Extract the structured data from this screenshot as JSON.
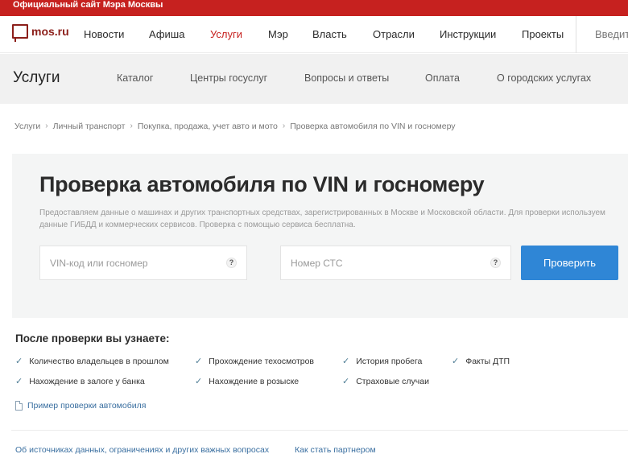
{
  "topbar": {
    "title": "Официальный сайт Мэра Москвы"
  },
  "header": {
    "logo_text": "mos.ru",
    "nav": [
      {
        "label": "Новости",
        "active": false
      },
      {
        "label": "Афиша",
        "active": false
      },
      {
        "label": "Услуги",
        "active": true
      },
      {
        "label": "Мэр",
        "active": false
      },
      {
        "label": "Власть",
        "active": false
      },
      {
        "label": "Отрасли",
        "active": false
      },
      {
        "label": "Инструкции",
        "active": false
      },
      {
        "label": "Проекты",
        "active": false
      }
    ],
    "search_placeholder": "Введите"
  },
  "subnav": {
    "title": "Услуги",
    "items": [
      "Каталог",
      "Центры госуслуг",
      "Вопросы и ответы",
      "Оплата",
      "О городских услугах"
    ]
  },
  "breadcrumb": {
    "items": [
      "Услуги",
      "Личный транспорт",
      "Покупка, продажа, учет авто и мото",
      "Проверка автомобиля по VIN и госномеру"
    ],
    "separator": "›"
  },
  "main": {
    "title": "Проверка автомобиля по VIN и госномеру",
    "description": "Предоставляем данные о машинах и других транспортных средствах, зарегистрированных в Москве и Московской области. Для проверки используем данные ГИБДД и коммерческих сервисов. Проверка с помощью сервиса бесплатна.",
    "vin_field": {
      "placeholder": "VIN-код или госномер",
      "value": "",
      "help": "?"
    },
    "sts_field": {
      "placeholder": "Номер СТС",
      "value": "",
      "help": "?"
    },
    "submit_label": "Проверить"
  },
  "results": {
    "title": "После проверки вы узнаете:",
    "features": [
      "Количество владельцев в прошлом",
      "Прохождение техосмотров",
      "История пробега",
      "Факты ДТП",
      "Нахождение в залоге у банка",
      "Нахождение в розыске",
      "Страховые случаи"
    ],
    "check_glyph": "✓",
    "sample_link": "Пример проверки автомобиля"
  },
  "footer": {
    "links": [
      "Об источниках данных, ограничениях и других важных вопросах",
      "Как стать партнером"
    ]
  },
  "colors": {
    "brand_red": "#c6211f",
    "button_blue": "#2f86d6",
    "link_blue": "#3a6fa0"
  }
}
